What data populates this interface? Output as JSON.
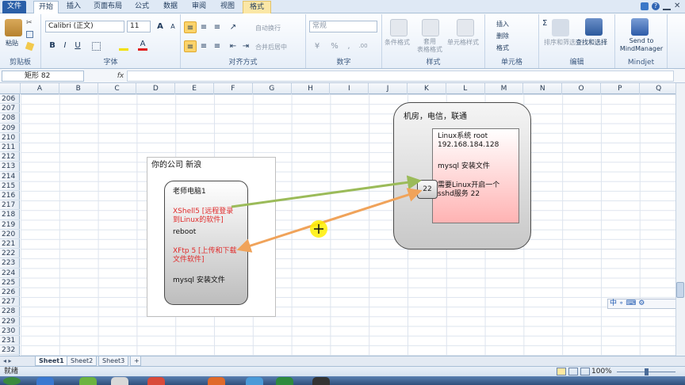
{
  "tabs": [
    "文件",
    "开始",
    "插入",
    "页面布局",
    "公式",
    "数据",
    "审阅",
    "视图",
    "格式"
  ],
  "clipboard": {
    "paste": "粘贴",
    "label": "剪贴板"
  },
  "font": {
    "name": "Calibri (正文)",
    "size": "11",
    "label": "字体",
    "bold": "B",
    "italic": "I",
    "underline": "U",
    "grow": "A",
    "shrink": "A"
  },
  "align": {
    "label": "对齐方式",
    "wrap": "自动换行",
    "merge": "合并后居中"
  },
  "number": {
    "format": "常规",
    "label": "数字",
    "percent": "%",
    "comma": ","
  },
  "styles": {
    "cond": "条件格式",
    "table": "套用\n表格格式",
    "cell": "单元格样式",
    "label": "样式"
  },
  "cells": {
    "insert": "插入",
    "delete": "删除",
    "format": "格式",
    "label": "单元格"
  },
  "editing": {
    "sort": "排序和筛选",
    "find": "查找和选择",
    "label": "编辑",
    "sigma": "Σ"
  },
  "mindjet": {
    "send": "Send to\nMindManager",
    "label": "Mindjet"
  },
  "namebox": "矩形  82",
  "fx": "fx",
  "columns": [
    "A",
    "B",
    "C",
    "D",
    "E",
    "F",
    "G",
    "H",
    "I",
    "J",
    "K",
    "L",
    "M",
    "N",
    "O",
    "P",
    "Q"
  ],
  "rows": [
    "206",
    "207",
    "208",
    "209",
    "210",
    "211",
    "212",
    "213",
    "214",
    "215",
    "216",
    "217",
    "218",
    "219",
    "220",
    "221",
    "222",
    "223",
    "224",
    "225",
    "226",
    "227",
    "228",
    "229",
    "230",
    "231",
    "232"
  ],
  "diagram": {
    "company_title": "你的公司 新浪",
    "pc_title": "老师电脑1",
    "xshell": "XShell5 [远程登录\n到Linux的软件]",
    "reboot": "reboot",
    "xftp": "XFtp 5 [上传和下载\n文件软件]",
    "mysql_left": "mysql 安装文件",
    "room_title": "机房，电信，联通",
    "linux_info": "Linux系统 root\n192.168.184.128",
    "mysql_right": "mysql 安装文件",
    "sshd": "需要Linux开启一个\nsshd服务 22",
    "port": "22",
    "colors": {
      "green_arrow": "#9bbb59",
      "orange_arrow": "#f0a35a",
      "pink_fill": "#ffb3b3",
      "xshell_text": "#e02b2b"
    }
  },
  "sheets": [
    "Sheet1",
    "Sheet2",
    "Sheet3"
  ],
  "status": {
    "ready": "就绪",
    "zoom": "100%"
  },
  "ime": "中 ∘ ⌨ ⚙"
}
